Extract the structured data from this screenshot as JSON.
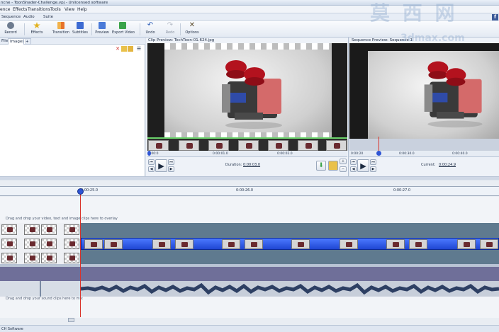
{
  "window": {
    "title": "ncne - ToonShader-Challenge.vpj - Unlicensed software"
  },
  "menu": {
    "items": [
      "ence",
      "Effects",
      "Transitions",
      "Tools",
      "View",
      "Help"
    ]
  },
  "sequence_tabs": [
    "Sequence",
    "Audio",
    "Suite"
  ],
  "toolbar": {
    "buttons": [
      "Record",
      "Effects",
      "Transition",
      "Subtitles",
      "Preview",
      "Export Video",
      "Undo",
      "Redo",
      "Options"
    ]
  },
  "media_panel": {
    "tabs": [
      "Files",
      "Images",
      "+"
    ]
  },
  "clip_preview": {
    "title": "Clip Preview: TechToon-01.624.jpg",
    "ruler_ticks": [
      "0:00:0",
      "0:00:01.0",
      "0:00:02.0"
    ],
    "duration_label": "Duration:",
    "duration_value": "0:00:03.0"
  },
  "sequence_preview": {
    "title": "Sequence Preview: Sequence 1",
    "ruler_ticks": [
      "0:00:20",
      "0:00:30.0",
      "0:00:40.0"
    ],
    "current_label": "Current:",
    "current_value": "0:00:24.9"
  },
  "timeline": {
    "scale": [
      "0:00:25.0",
      "0:00:26.0",
      "0:00:27.0"
    ],
    "overlay_hint": "Drag and drop your video, text and image clips here to overlay",
    "audio_hint": "Drag and drop your sound clips here to mix"
  },
  "status": {
    "text": "CH Software"
  },
  "watermark": {
    "chars": "莫 西 网",
    "url": "3dmax.com"
  },
  "colors": {
    "clip_blue": "#1f46d2",
    "playhead": "#d9332b",
    "audio_track": "#6f6f99"
  }
}
